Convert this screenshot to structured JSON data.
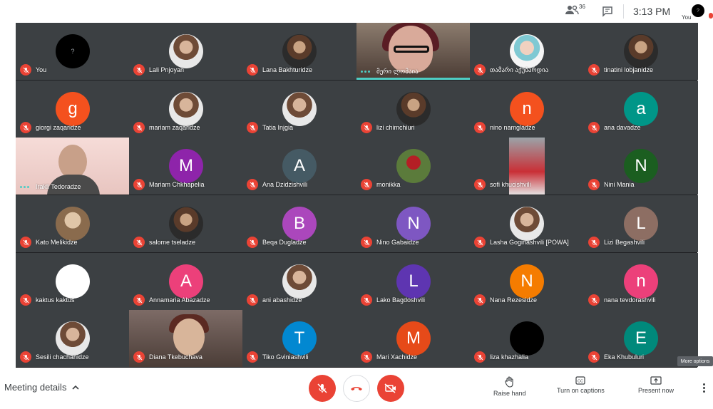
{
  "topbar": {
    "participant_count": "36",
    "time": "3:13 PM",
    "self_label": "You",
    "self_initial": "?"
  },
  "participants": [
    {
      "name": "You",
      "avatar": "?",
      "kind": "blank",
      "color": "#000000",
      "status": "muted"
    },
    {
      "name": "Lali Pnjoyan",
      "avatar": "",
      "kind": "photo-light",
      "status": "muted"
    },
    {
      "name": "Lana Bakhturidze",
      "avatar": "",
      "kind": "photo",
      "status": "muted"
    },
    {
      "name": "მერი ლომაია",
      "avatar": "",
      "kind": "video-1",
      "status": "speaking"
    },
    {
      "name": "თამარი აქუბარდია",
      "avatar": "",
      "kind": "photo-glasses",
      "status": "muted"
    },
    {
      "name": "tinatini lobjanidze",
      "avatar": "",
      "kind": "photo",
      "status": "muted"
    },
    {
      "name": "giorgi zaqaridze",
      "avatar": "g",
      "kind": "letter",
      "color": "#f4511e",
      "status": "muted"
    },
    {
      "name": "mariam zaqaridze",
      "avatar": "",
      "kind": "photo-light",
      "status": "muted"
    },
    {
      "name": "Tatia Injgia",
      "avatar": "",
      "kind": "photo-light",
      "status": "muted"
    },
    {
      "name": "lizi chimchiuri",
      "avatar": "",
      "kind": "photo",
      "status": "muted"
    },
    {
      "name": "nino namgladze",
      "avatar": "n",
      "kind": "letter",
      "color": "#f4511e",
      "status": "muted"
    },
    {
      "name": "ana davadze",
      "avatar": "a",
      "kind": "letter",
      "color": "#009688",
      "status": "muted"
    },
    {
      "name": "Irakli Tedoradze",
      "avatar": "",
      "kind": "video-2",
      "status": "speaking"
    },
    {
      "name": "Mariam Chkhapelia",
      "avatar": "M",
      "kind": "letter",
      "color": "#8e24aa",
      "status": "muted"
    },
    {
      "name": "Ana Dzidzishvili",
      "avatar": "A",
      "kind": "letter",
      "color": "#455a64",
      "status": "muted"
    },
    {
      "name": "monikka",
      "avatar": "",
      "kind": "photo-green",
      "status": "muted"
    },
    {
      "name": "sofi khucishvili",
      "avatar": "",
      "kind": "video-4",
      "status": "muted"
    },
    {
      "name": "Nini Mania",
      "avatar": "N",
      "kind": "letter",
      "color": "#1b5e20",
      "status": "muted"
    },
    {
      "name": "Kato Melikidze",
      "avatar": "",
      "kind": "photo-doll",
      "status": "muted"
    },
    {
      "name": "salome tseladze",
      "avatar": "",
      "kind": "photo",
      "status": "muted"
    },
    {
      "name": "Beqa Dugladze",
      "avatar": "B",
      "kind": "letter",
      "color": "#ab47bc",
      "status": "muted"
    },
    {
      "name": "Nino Gabaidze",
      "avatar": "N",
      "kind": "letter",
      "color": "#7e57c2",
      "status": "muted"
    },
    {
      "name": "Lasha Goginashvili [POWA]",
      "avatar": "",
      "kind": "photo-light",
      "status": "muted"
    },
    {
      "name": "Lizi Begashvili",
      "avatar": "L",
      "kind": "letter",
      "color": "#8d6e63",
      "status": "muted"
    },
    {
      "name": "kaktus kaktus",
      "avatar": "",
      "kind": "blank",
      "color": "#ffffff",
      "status": "muted"
    },
    {
      "name": "Annamaria Abazadze",
      "avatar": "A",
      "kind": "letter",
      "color": "#ec407a",
      "status": "muted"
    },
    {
      "name": "ani abashidze",
      "avatar": "",
      "kind": "photo-light",
      "status": "muted"
    },
    {
      "name": "Lako Bagdoshvili",
      "avatar": "L",
      "kind": "letter",
      "color": "#5e35b1",
      "status": "muted"
    },
    {
      "name": "Nana Rezesidze",
      "avatar": "N",
      "kind": "letter",
      "color": "#f57c00",
      "status": "muted"
    },
    {
      "name": "nana tevdorashvili",
      "avatar": "n",
      "kind": "letter",
      "color": "#ec407a",
      "status": "muted"
    },
    {
      "name": "Sesili chachanidze",
      "avatar": "",
      "kind": "photo-light",
      "status": "muted"
    },
    {
      "name": "Diana Tkebuchava",
      "avatar": "",
      "kind": "video-3",
      "status": "muted"
    },
    {
      "name": "Tiko Gviniashvili",
      "avatar": "T",
      "kind": "letter",
      "color": "#0288d1",
      "status": "muted"
    },
    {
      "name": "Mari Xachidze",
      "avatar": "M",
      "kind": "letter",
      "color": "#e64a19",
      "status": "muted"
    },
    {
      "name": "liza khazhalia",
      "avatar": "",
      "kind": "blank",
      "color": "#000000",
      "status": "muted"
    },
    {
      "name": "Eka Khubuluri",
      "avatar": "E",
      "kind": "letter",
      "color": "#00897b",
      "status": "muted"
    }
  ],
  "tooltip": {
    "more_options": "More options"
  },
  "bottombar": {
    "meeting_details": "Meeting details",
    "raise_hand": "Raise hand",
    "captions": "Turn on captions",
    "present": "Present now"
  },
  "colors": {
    "accent_red": "#ea4335",
    "grid_bg": "#202124",
    "tile_bg": "#3c4043",
    "speaking": "#4ecdc4"
  }
}
